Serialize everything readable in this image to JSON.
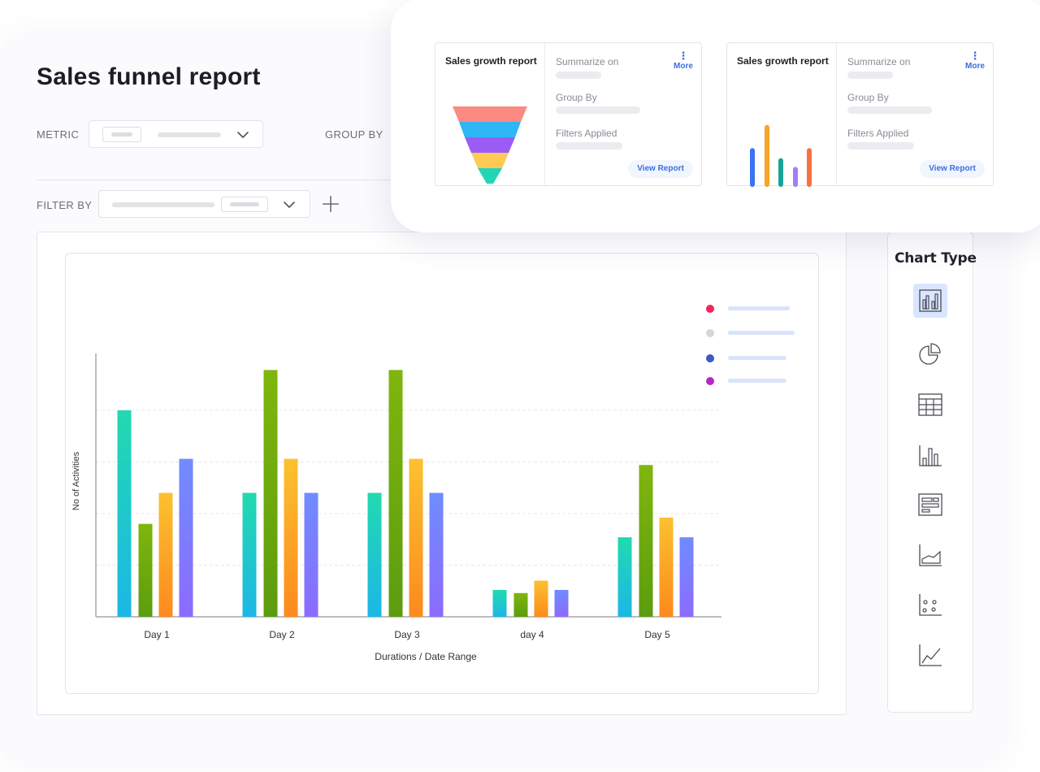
{
  "page": {
    "title": "Sales funnel report"
  },
  "filters": {
    "metric_label": "METRIC",
    "group_by_label": "GROUP BY",
    "filter_by_label": "FILTER BY"
  },
  "chart_type_panel": {
    "title": "Chart Type",
    "options": [
      {
        "icon": "grouped-bar-chart-icon",
        "active": true
      },
      {
        "icon": "pie-chart-icon",
        "active": false
      },
      {
        "icon": "table-icon",
        "active": false
      },
      {
        "icon": "bar-chart-icon",
        "active": false
      },
      {
        "icon": "horizontal-bar-chart-icon",
        "active": false
      },
      {
        "icon": "area-chart-icon",
        "active": false
      },
      {
        "icon": "scatter-chart-icon",
        "active": false
      },
      {
        "icon": "line-chart-icon",
        "active": false
      }
    ]
  },
  "report_cards": [
    {
      "title": "Sales growth report",
      "fields": [
        "Summarize on",
        "Group By",
        "Filters Applied"
      ],
      "more_label": "More",
      "view_label": "View Report",
      "preview": "funnel",
      "funnel_colors": [
        "#fb8a80",
        "#2fb6f5",
        "#9b5cf5",
        "#fdca56",
        "#22d5b7"
      ]
    },
    {
      "title": "Sales growth report",
      "fields": [
        "Summarize on",
        "Group By",
        "Filters Applied"
      ],
      "more_label": "More",
      "view_label": "View Report",
      "preview": "bars",
      "bar_values": [
        0.62,
        0.99,
        0.46,
        0.32,
        0.62
      ],
      "bar_colors": [
        "#3b73f3",
        "#f7a428",
        "#1aa39a",
        "#a77cf5",
        "#f97040"
      ]
    }
  ],
  "chart_data": {
    "type": "bar",
    "title": "",
    "xlabel": "Durations / Date Range",
    "ylabel": "No of Activities",
    "categories": [
      "Day 1",
      "Day 2",
      "Day 3",
      "day 4",
      "Day 5"
    ],
    "ylim": [
      0,
      5.1
    ],
    "grid": true,
    "legend_placement": "top-right",
    "series": [
      {
        "values": [
          4.0,
          2.4,
          2.4,
          0.52,
          1.54
        ],
        "color_top": "#22d9b0",
        "color_bottom": "#1cb7e6"
      },
      {
        "values": [
          1.8,
          4.78,
          4.78,
          0.46,
          2.94
        ],
        "color_top": "#7fb60d",
        "color_bottom": "#5c9c0f"
      },
      {
        "values": [
          2.4,
          3.06,
          3.06,
          0.7,
          1.92
        ],
        "color_top": "#fcc12f",
        "color_bottom": "#fd8a1e"
      },
      {
        "values": [
          3.06,
          2.4,
          2.4,
          0.52,
          1.54
        ],
        "color_top": "#6f8cff",
        "color_bottom": "#8c6bff"
      }
    ],
    "legend_dots": [
      "#f5245a",
      "#d6d6da",
      "#3f56c8",
      "#b628c2"
    ]
  }
}
